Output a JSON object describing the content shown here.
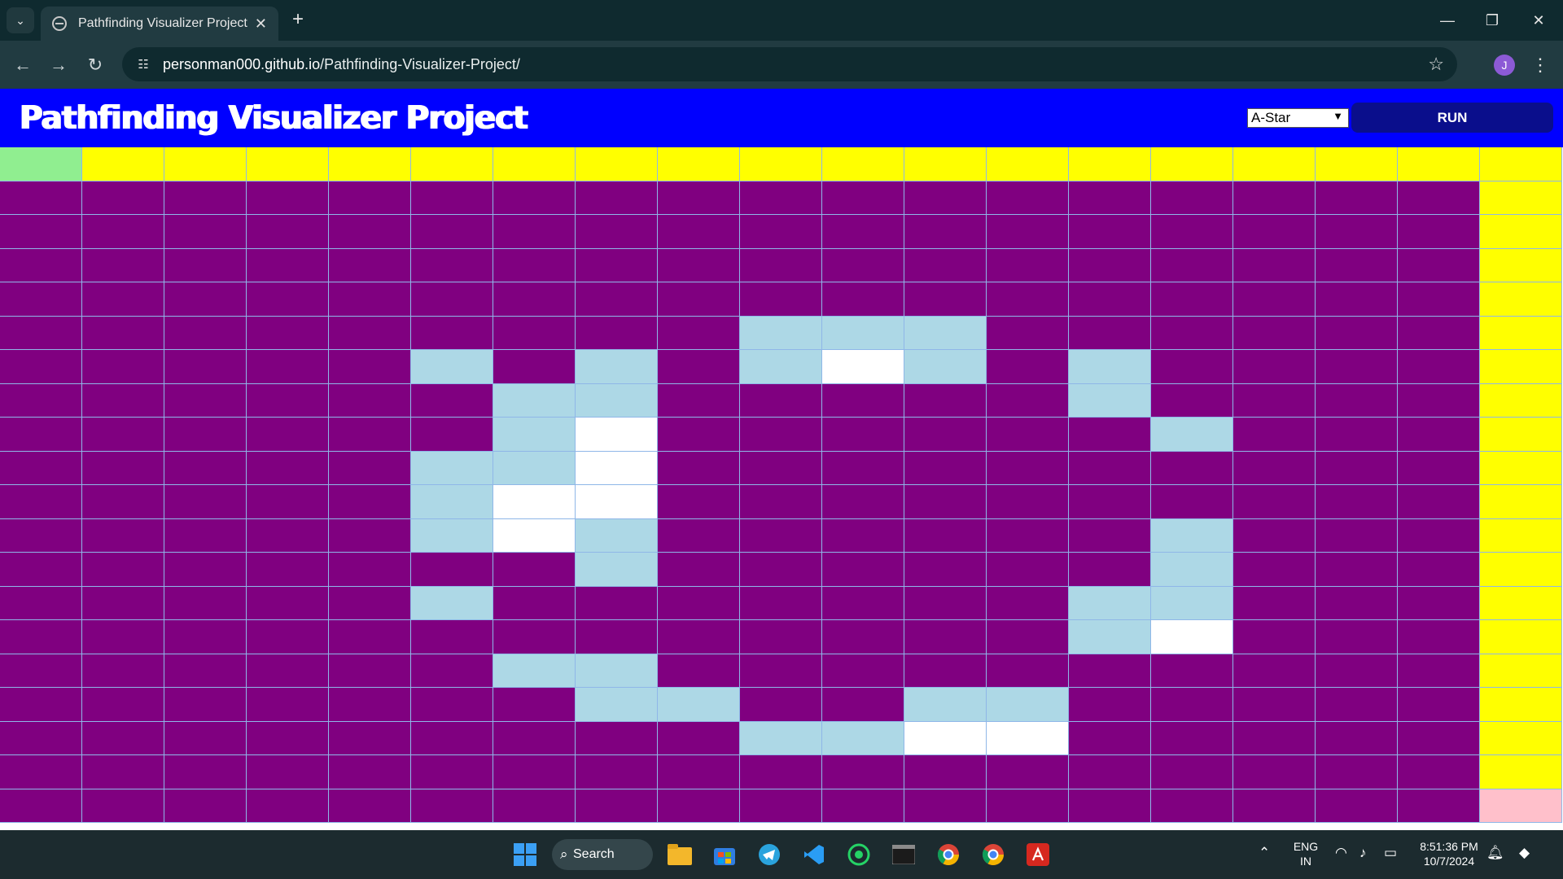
{
  "browser": {
    "tab_title": "Pathfinding Visualizer Project",
    "url_host": "personman000.github.io",
    "url_path": "/Pathfinding-Visualizer-Project/",
    "profile_initial": "J"
  },
  "app": {
    "title": "Pathfinding Visualizer Project",
    "algorithm_selected": "A-Star",
    "run_label": "RUN",
    "header_color": "#0000ff"
  },
  "grid": {
    "columns": 19,
    "rows": 20,
    "legend_colors": {
      "S": "#90ee90",
      "P": "#ffff00",
      "V": "#800080",
      "W": "#add8e6",
      "O": "#ffffff",
      "G": "#ffc0cb"
    },
    "cells": [
      "SPPPPPPPPPPPPPPPPPP",
      "VVVVVVVVVVVVVVVVVVP",
      "VVVVVVVVVVVVVVVVVVP",
      "VVVVVVVVVVVVVVVVVVP",
      "VVVVVVVVVVVVVVVVVVP",
      "VVVVVVVVVWWWVVVVVVP",
      "VVVVVWVWVWOWVWVVVVP",
      "VVVVVVWWVVVVVWVVVVP",
      "VVVVVVWOVVVVVVWVVVP",
      "VVVVVWWOVVVVVVVVVVP",
      "VVVVVWOOVVVVVVVVVVP",
      "VVVVVWOWVVVVVVWVVVP",
      "VVVVVVVWVVVVVVWVVVP",
      "VVVVVWVVVVVVVWWVVVP",
      "VVVVVVVVVVVVVWOVVVP",
      "VVVVVVWWVVVVVVVVVVP",
      "VVVVVVVWWVVWWVVVVVP",
      "VVVVVVVVVWWOOVVVVVP",
      "VVVVVVVVVVVVVVVVVVP",
      "VVVVVVVVVVVVVVVVVVG"
    ]
  },
  "taskbar": {
    "search_label": "Search",
    "lang_line1": "ENG",
    "lang_line2": "IN",
    "time": "8:51:36 PM",
    "date": "10/7/2024"
  }
}
